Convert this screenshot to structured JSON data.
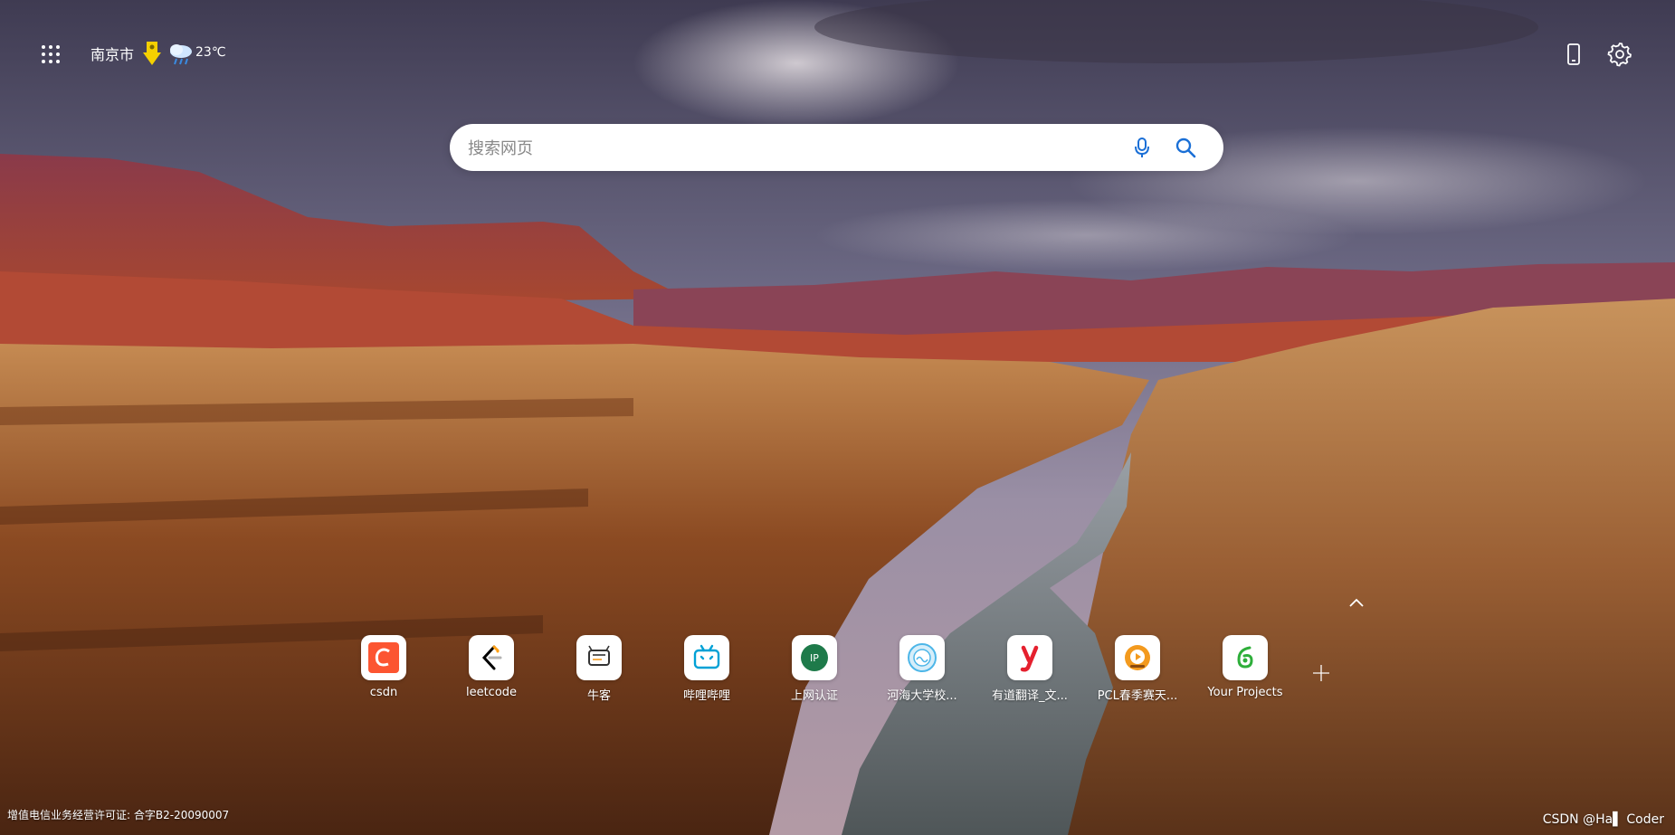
{
  "topbar": {
    "city": "南京市",
    "temperature": "23℃"
  },
  "search": {
    "placeholder": "搜索网页"
  },
  "shortcuts": [
    {
      "label": "csdn",
      "icon": "csdn-icon",
      "color": "#fc5531"
    },
    {
      "label": "leetcode",
      "icon": "leetcode-icon",
      "color": "#ffa116"
    },
    {
      "label": "牛客",
      "icon": "nowcoder-icon",
      "color": "#1d9f66"
    },
    {
      "label": "哔哩哔哩",
      "icon": "bilibili-icon",
      "color": "#00a1d6"
    },
    {
      "label": "上网认证",
      "icon": "ip-icon",
      "color": "#1e7a4a"
    },
    {
      "label": "河海大学校...",
      "icon": "hhu-icon",
      "color": "#4db6e8"
    },
    {
      "label": "有道翻译_文...",
      "icon": "youdao-icon",
      "color": "#e5202e"
    },
    {
      "label": "PCL春季赛天...",
      "icon": "pcl-icon",
      "color": "#f39a1e"
    },
    {
      "label": "Your Projects",
      "icon": "leaf-icon",
      "color": "#2eae3a"
    }
  ],
  "footer": {
    "license": "增值电信业务经营许可证: 合字B2-20090007",
    "watermark": "CSDN @Ha▌ Coder"
  },
  "colors": {
    "search_icon": "#1a6fd6",
    "text": "#ffffff"
  }
}
